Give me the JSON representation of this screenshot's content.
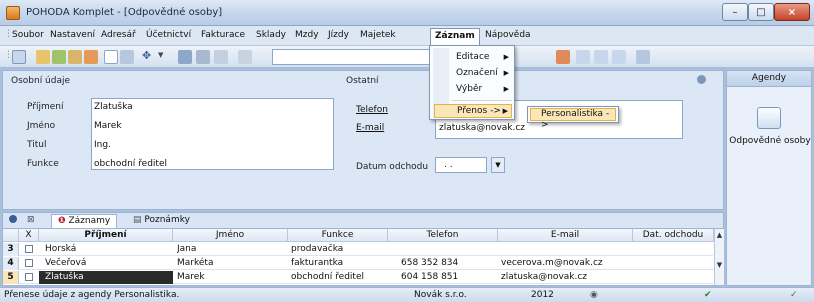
{
  "window": {
    "title": "POHODA Komplet - [Odpovědné osoby]"
  },
  "menubar": {
    "items": [
      "Soubor",
      "Nastavení",
      "Adresář",
      "Účetnictví",
      "Fakturace",
      "Sklady",
      "Mzdy",
      "Jízdy",
      "Majetek",
      "Záznam",
      "Nápověda"
    ]
  },
  "dropdown": {
    "items": [
      "Editace",
      "Označení",
      "Výběr",
      "Přenos ->"
    ],
    "submenu": "Personalistika ->"
  },
  "form": {
    "personal_group": "Osobní údaje",
    "other_group": "Ostatní",
    "labels": {
      "surname": "Příjmení",
      "name": "Jméno",
      "title": "Titul",
      "function": "Funkce",
      "phone": "Telefon",
      "email": "E-mail",
      "leave_date": "Datum odchodu"
    },
    "values": {
      "surname": "Zlatuška",
      "name": "Marek",
      "title": "Ing.",
      "function": "obchodní ředitel",
      "phone": "",
      "email": "zlatuska@novak.cz",
      "leave_date": ". ."
    }
  },
  "agendas": {
    "header": "Agendy",
    "item_label": "Odpovědné osoby"
  },
  "tabs": {
    "records": "Záznamy",
    "notes": "Poznámky"
  },
  "grid": {
    "columns": [
      "X",
      "Příjmení",
      "Jméno",
      "Funkce",
      "Telefon",
      "E-mail",
      "Dat. odchodu"
    ],
    "rows": [
      {
        "num": "3",
        "surname": "Horská",
        "name": "Jana",
        "function": "prodavačka",
        "phone": "",
        "email": "",
        "leave": ""
      },
      {
        "num": "4",
        "surname": "Večeřová",
        "name": "Markéta",
        "function": "fakturantka",
        "phone": "658 352 834",
        "email": "vecerova.m@novak.cz",
        "leave": ""
      },
      {
        "num": "5",
        "surname": "Zlatuška",
        "name": "Marek",
        "function": "obchodní ředitel",
        "phone": "604 158 851",
        "email": "zlatuska@novak.cz",
        "leave": ""
      }
    ]
  },
  "statusbar": {
    "message": "Přenese údaje z agendy Personalistika.",
    "company": "Novák s.r.o.",
    "year": "2012"
  },
  "colors": {
    "accent": "#3a5f96",
    "highlight": "#fbe6b7",
    "selected_row": "#2b2b2b"
  }
}
